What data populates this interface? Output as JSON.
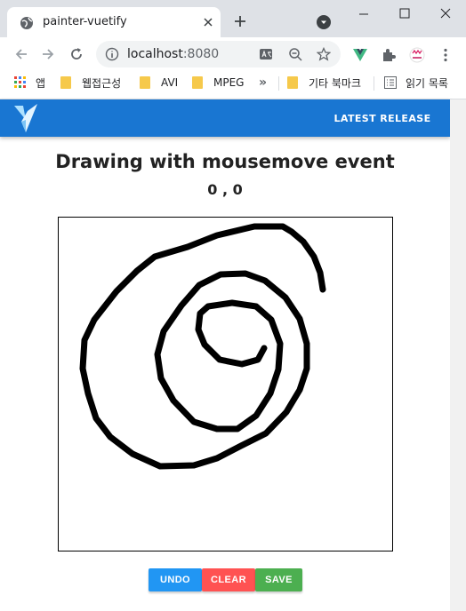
{
  "browser": {
    "tab_title": "painter-vuetify",
    "url_host": "localhost",
    "url_port": ":8080",
    "bookmarks": [
      "앱",
      "웹접근성",
      "AVI",
      "MPEG",
      "기타 북마크",
      "읽기 목록"
    ],
    "overflow_chevron": "»"
  },
  "app": {
    "release_label": "LATEST RELEASE",
    "title": "Drawing with mousemove event",
    "coords": "0 , 0",
    "buttons": {
      "undo": "UNDO",
      "clear": "CLEAR",
      "save": "SAVE"
    },
    "colors": {
      "app_bar": "#1976d2",
      "undo": "#2196f3",
      "clear": "#ff5252",
      "save": "#4caf50",
      "stroke": "#000000"
    }
  }
}
